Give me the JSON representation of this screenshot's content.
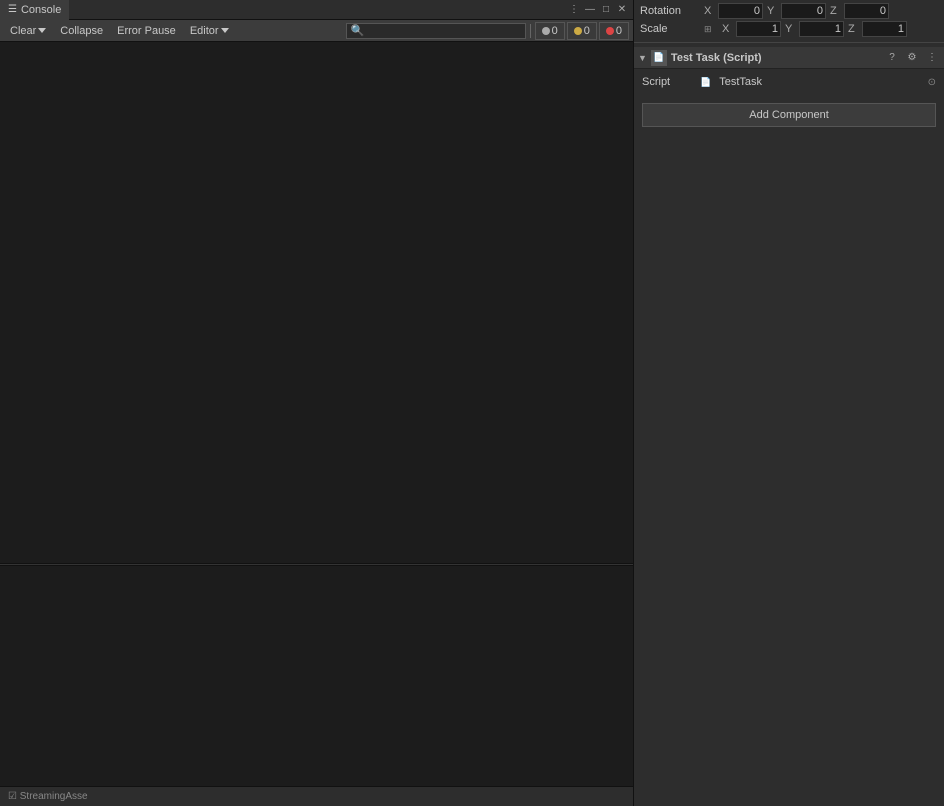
{
  "console": {
    "tab_label": "Console",
    "toolbar": {
      "clear_label": "Clear",
      "clear_dropdown": "▾",
      "collapse_label": "Collapse",
      "error_pause_label": "Error Pause",
      "editor_label": "Editor",
      "editor_dropdown": "▾",
      "search_placeholder": "🔍"
    },
    "badges": {
      "info_count": "0",
      "warning_count": "0",
      "error_count": "0"
    },
    "bottom_bar_label": "☑ StreamingAsse"
  },
  "inspector": {
    "rotation": {
      "label": "Rotation",
      "x_label": "X",
      "x_value": "0",
      "y_label": "Y",
      "y_value": "0",
      "z_label": "Z",
      "z_value": "0"
    },
    "scale": {
      "label": "Scale",
      "icon": "⊞",
      "x_label": "X",
      "x_value": "1",
      "y_label": "Y",
      "y_value": "1",
      "z_label": "Z",
      "z_value": "1"
    },
    "component": {
      "title": "Test Task (Script)",
      "icon": "📄",
      "script_label": "Script",
      "script_icon": "📄",
      "script_name": "TestTask",
      "help_label": "?",
      "settings_label": "⚙",
      "menu_label": "⋮"
    },
    "add_component_label": "Add Component"
  },
  "tab_controls": {
    "more_label": "⋮",
    "minimize_label": "—",
    "maximize_label": "□",
    "close_label": "✕"
  }
}
